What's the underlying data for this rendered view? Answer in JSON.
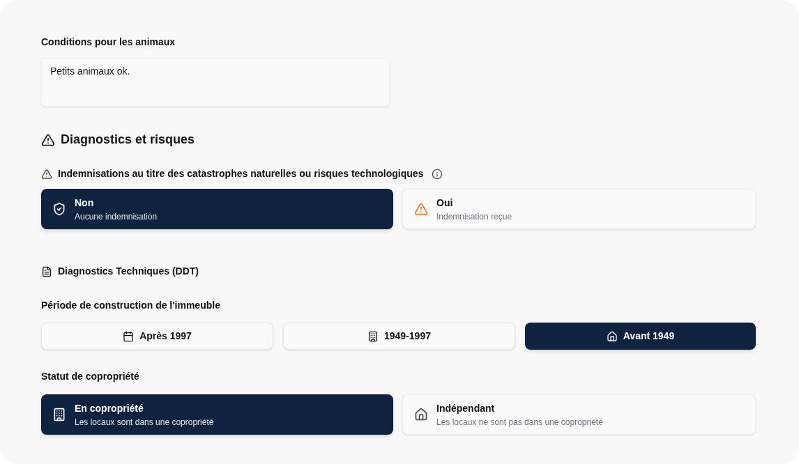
{
  "pets": {
    "label": "Conditions pour les animaux",
    "value": "Petits animaux ok."
  },
  "section": {
    "title": "Diagnostics et risques"
  },
  "indemnisation": {
    "label": "Indemnisations au titre des catastrophes naturelles ou risques technologiques",
    "options": [
      {
        "title": "Non",
        "subtitle": "Aucune indemnisation",
        "selected": true
      },
      {
        "title": "Oui",
        "subtitle": "Indemnisation reçue",
        "selected": false
      }
    ]
  },
  "ddt": {
    "title": "Diagnostics Techniques (DDT)"
  },
  "period": {
    "label": "Période de construction de l'immeuble",
    "options": [
      {
        "label": "Après 1997",
        "selected": false
      },
      {
        "label": "1949-1997",
        "selected": false
      },
      {
        "label": "Avant 1949",
        "selected": true
      }
    ]
  },
  "copro": {
    "label": "Statut de copropriété",
    "options": [
      {
        "title": "En copropriété",
        "subtitle": "Les locaux sont dans une copropriété",
        "selected": true
      },
      {
        "title": "Indépendant",
        "subtitle": "Les locaux ne sont pas dans une copropriété",
        "selected": false
      }
    ]
  }
}
